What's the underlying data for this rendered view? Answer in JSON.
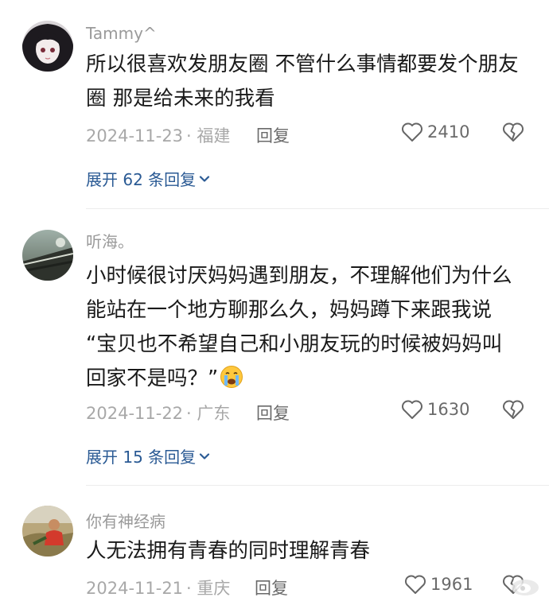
{
  "comments": [
    {
      "username": "Tammy^",
      "lines": [
        "所以很喜欢发朋友圈 不管什么事情都要发个朋友",
        "圈 那是给未来的我看"
      ],
      "date": "2024-11-23",
      "location": "· 福建",
      "reply_label": "回复",
      "likes": "2410",
      "expand_label": "展开 62 条回复"
    },
    {
      "username": "听海。",
      "lines": [
        "小时候很讨厌妈妈遇到朋友，不理解他们为什么",
        "能站在一个地方聊那么久，妈妈蹲下来跟我说",
        "“宝贝也不希望自己和小朋友玩的时候被妈妈叫",
        "回家不是吗？”"
      ],
      "emoji": "crying-face",
      "date": "2024-11-22",
      "location": "· 广东",
      "reply_label": "回复",
      "likes": "1630",
      "expand_label": "展开 15 条回复"
    },
    {
      "username": "你有神经病",
      "lines": [
        "人无法拥有青春的同时理解青春"
      ],
      "date": "2024-11-21",
      "location": "· 重庆",
      "reply_label": "回复",
      "likes": "1961"
    }
  ],
  "colors": {
    "link": "#2a5a94",
    "meta": "#a8a8a8",
    "text": "#1a1a1a"
  }
}
